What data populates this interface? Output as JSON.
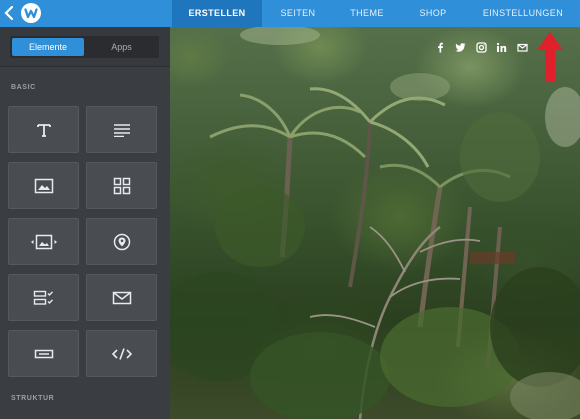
{
  "topbar": {
    "nav": [
      {
        "label": "ERSTELLEN"
      },
      {
        "label": "SEITEN"
      },
      {
        "label": "THEME"
      },
      {
        "label": "SHOP"
      },
      {
        "label": "EINSTELLUNGEN"
      }
    ],
    "active_index": 0,
    "accent": "#2f8fd8"
  },
  "sidebar": {
    "segmented": {
      "left": "Elemente",
      "right": "Apps",
      "selected": "Elemente"
    },
    "sections": [
      {
        "label": "BASIC"
      },
      {
        "label": "STRUKTUR"
      }
    ],
    "tiles": [
      {
        "icon": "text-icon"
      },
      {
        "icon": "paragraph-icon"
      },
      {
        "icon": "image-icon"
      },
      {
        "icon": "gallery-icon"
      },
      {
        "icon": "slideshow-icon"
      },
      {
        "icon": "map-pin-icon"
      },
      {
        "icon": "form-icon"
      },
      {
        "icon": "email-icon"
      },
      {
        "icon": "button-icon"
      },
      {
        "icon": "code-icon"
      }
    ]
  },
  "canvas": {
    "social_icons": [
      "facebook-icon",
      "twitter-icon",
      "instagram-icon",
      "linkedin-icon",
      "mail-icon"
    ],
    "arrow_color": "#e0202a"
  }
}
